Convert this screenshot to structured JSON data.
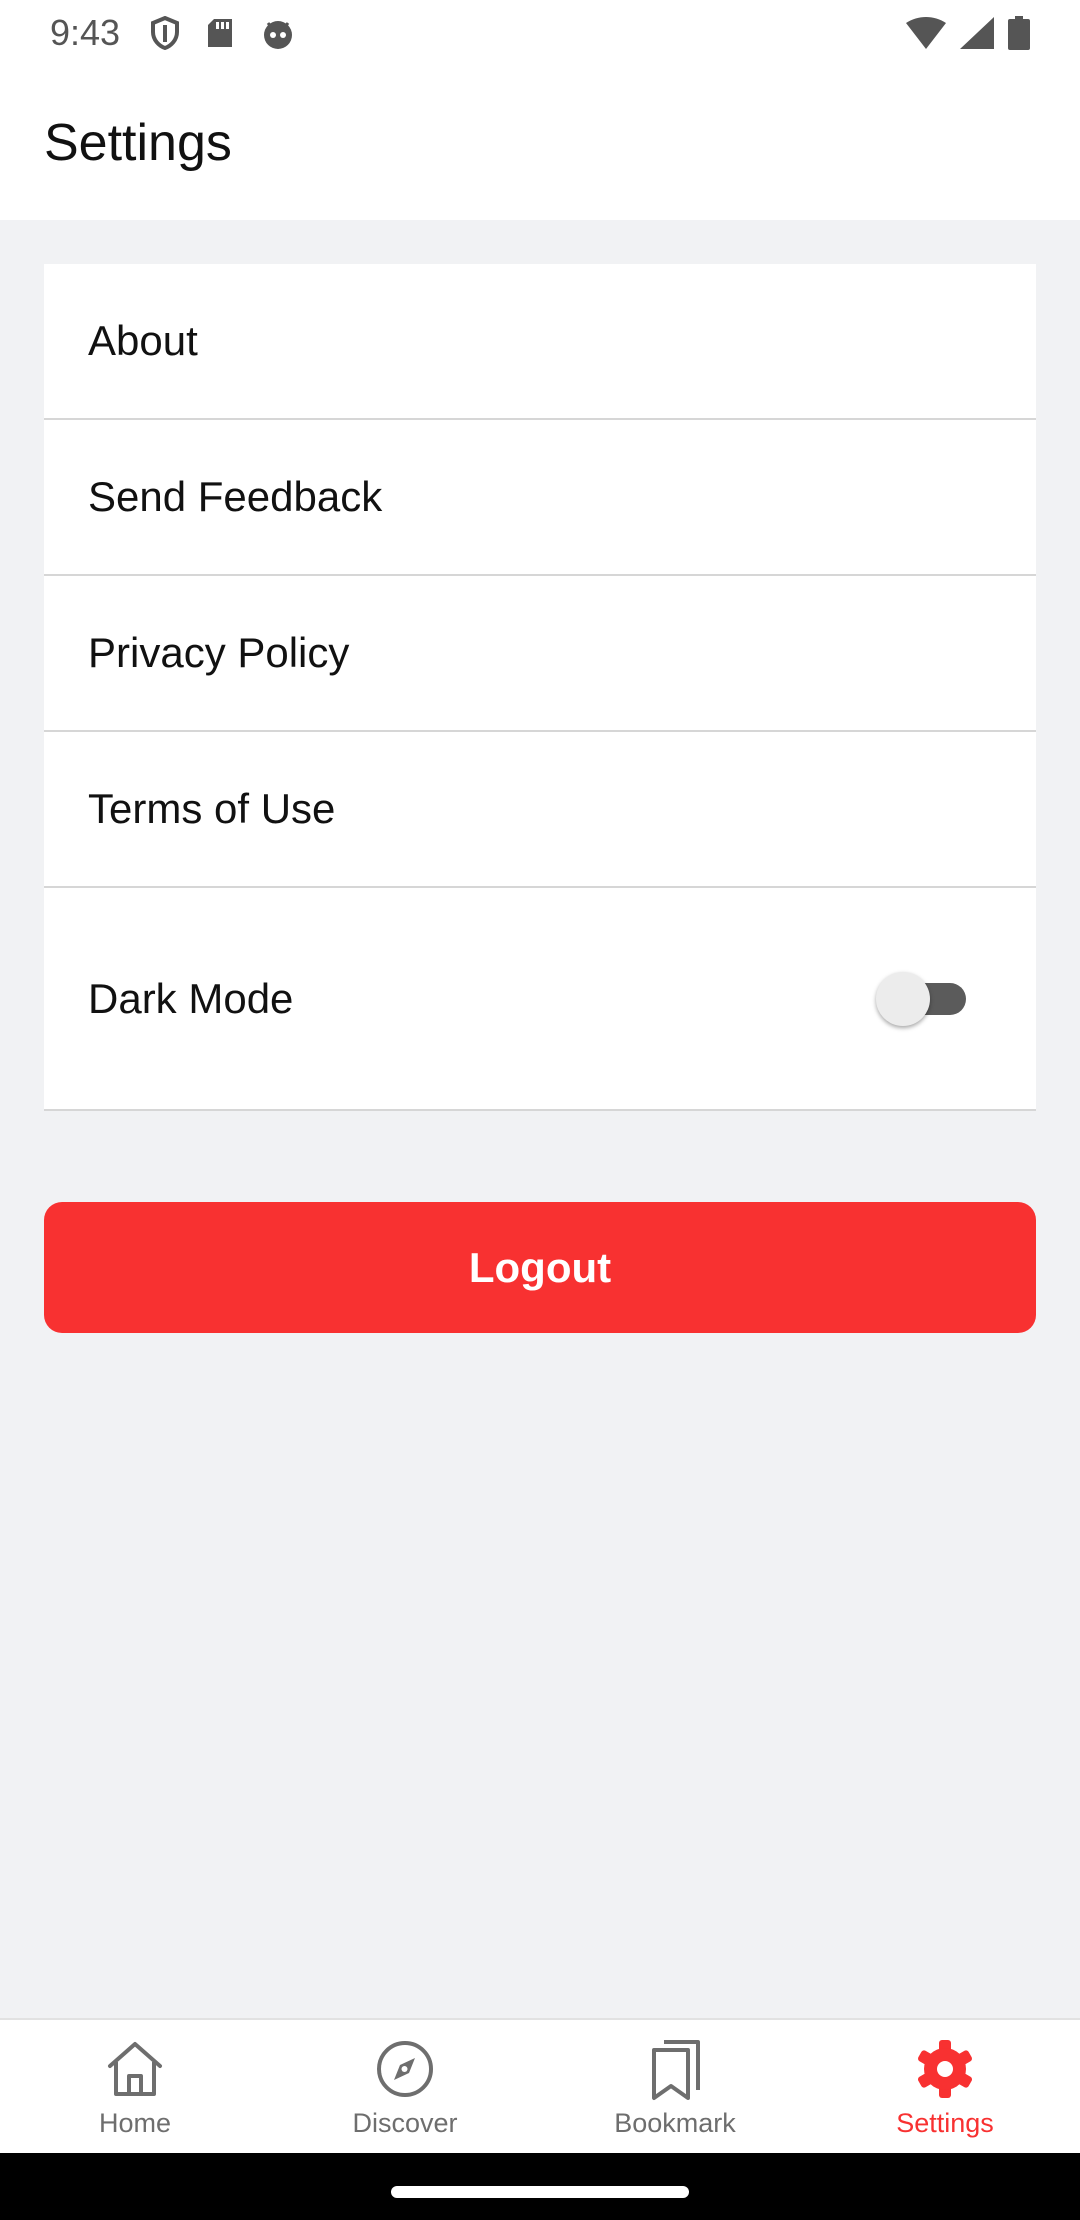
{
  "status_bar": {
    "time": "9:43",
    "left_icons": [
      "shield-icon",
      "sd-card-icon",
      "android-face-icon"
    ],
    "right_icons": [
      "wifi-icon",
      "signal-icon",
      "battery-icon"
    ]
  },
  "header": {
    "title": "Settings"
  },
  "settings": {
    "items": [
      {
        "label": "About"
      },
      {
        "label": "Send Feedback"
      },
      {
        "label": "Privacy Policy"
      },
      {
        "label": "Terms of Use"
      },
      {
        "label": "Dark Mode",
        "toggle_on": false
      }
    ]
  },
  "logout": {
    "label": "Logout"
  },
  "colors": {
    "accent": "#F83131",
    "background": "#F1F2F4",
    "inactive": "#6E6E6E"
  },
  "bottom_nav": {
    "items": [
      {
        "label": "Home",
        "icon": "home-icon"
      },
      {
        "label": "Discover",
        "icon": "compass-icon"
      },
      {
        "label": "Bookmark",
        "icon": "bookmark-icon"
      },
      {
        "label": "Settings",
        "icon": "gear-icon",
        "active": true
      }
    ]
  }
}
